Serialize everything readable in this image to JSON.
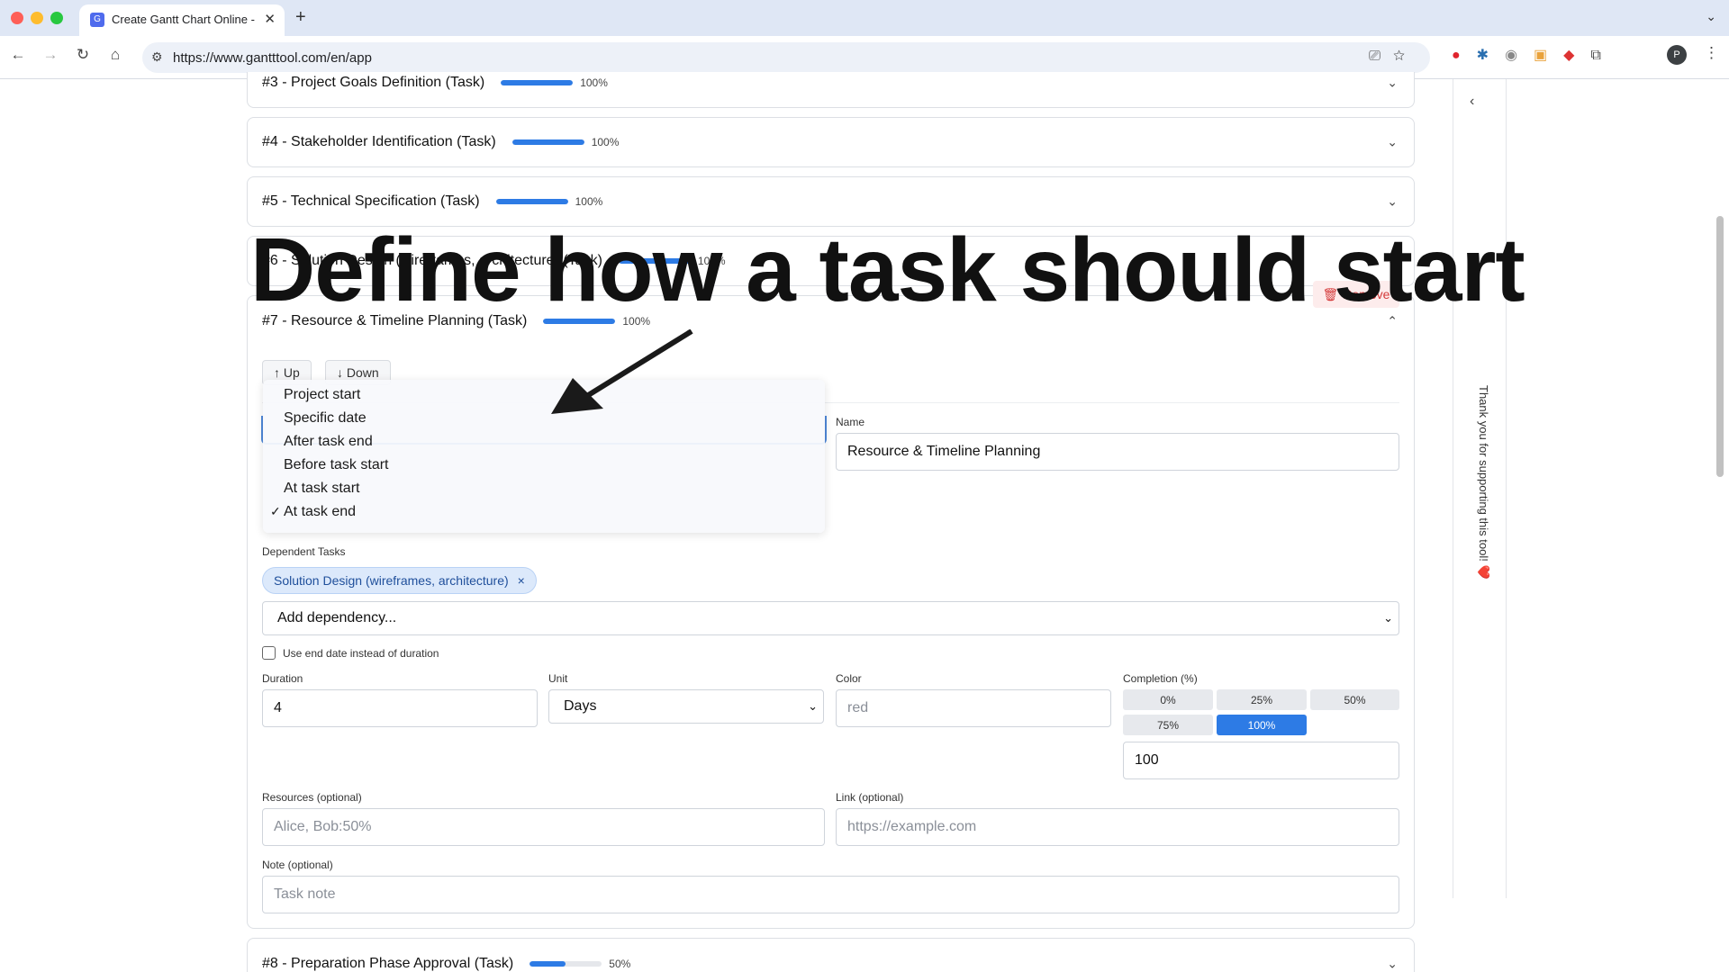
{
  "browser": {
    "tab_title": "Create Gantt Chart Online - F",
    "tab_favicon": "G",
    "url": "https://www.gantttool.com/en/app",
    "profile_initial": "P"
  },
  "overlay": {
    "headline": "Define how a task should start"
  },
  "tasks": [
    {
      "title": "#3 - Project Goals Definition (Task)",
      "progress": 100,
      "progress_label": "100%"
    },
    {
      "title": "#4 - Stakeholder Identification (Task)",
      "progress": 100,
      "progress_label": "100%"
    },
    {
      "title": "#5 - Technical Specification (Task)",
      "progress": 100,
      "progress_label": "100%"
    },
    {
      "title": "#6 - Solution Design (wireframes, architecture) (Task)",
      "progress": 100,
      "progress_label": "100%"
    },
    {
      "title": "#7 - Resource & Timeline Planning (Task)",
      "progress": 100,
      "progress_label": "100%"
    },
    {
      "title": "#8 - Preparation Phase Approval (Task)",
      "progress": 50,
      "progress_label": "50%"
    }
  ],
  "editor": {
    "up_label": "Up",
    "down_label": "Down",
    "remove_label": "Remove",
    "start_options": [
      "Project start",
      "Specific date",
      "After task end",
      "Before task start",
      "At task start",
      "At task end"
    ],
    "selected_start": "At task end",
    "name_label": "Name",
    "name_value": "Resource & Timeline Planning",
    "dependent_label": "Dependent Tasks",
    "dependency_chip": "Solution Design (wireframes, architecture)",
    "add_dependency": "Add dependency...",
    "use_end_date": "Use end date instead of duration",
    "duration_label": "Duration",
    "duration_value": "4",
    "unit_label": "Unit",
    "unit_value": "Days",
    "color_label": "Color",
    "color_placeholder": "red",
    "completion_label": "Completion (%)",
    "completion_presets": [
      "0%",
      "25%",
      "50%",
      "75%",
      "100%"
    ],
    "completion_value": "100",
    "resources_label": "Resources (optional)",
    "resources_placeholder": "Alice, Bob:50%",
    "link_label": "Link (optional)",
    "link_placeholder": "https://example.com",
    "note_label": "Note (optional)",
    "note_placeholder": "Task note"
  },
  "sidepanel": {
    "text": "Thank you for supporting this tool! ❤️"
  },
  "colors": {
    "accent": "#2d7be5",
    "danger": "#d43a3a",
    "chip_bg": "#dce9fb"
  }
}
